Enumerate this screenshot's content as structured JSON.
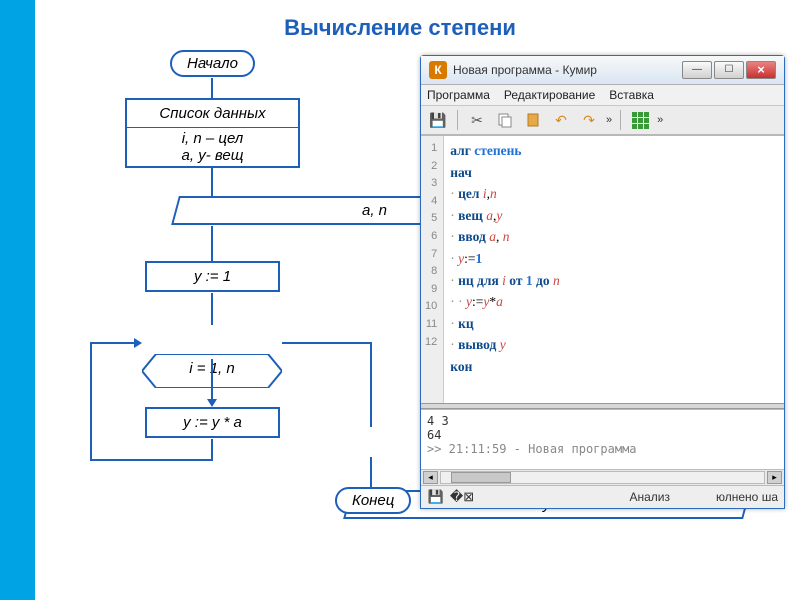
{
  "page": {
    "title": "Вычисление степени"
  },
  "flow": {
    "start": "Начало",
    "data_label": "Список данных",
    "types_int": "i, n – цел",
    "types_real": "a, y- вещ",
    "input": "a, n",
    "init": "y := 1",
    "loop": "i = 1, n",
    "body": "y := y * a",
    "output": "y",
    "end": "Конец"
  },
  "window": {
    "app_icon_letter": "К",
    "title": "Новая программа - Кумир",
    "menu": {
      "program": "Программа",
      "edit": "Редактирование",
      "insert": "Вставка"
    },
    "code_lines": [
      {
        "n": 1,
        "raw": "алг степень"
      },
      {
        "n": 2,
        "raw": "нач"
      },
      {
        "n": 3,
        "raw": "· цел i,n"
      },
      {
        "n": 4,
        "raw": "· вещ a,y"
      },
      {
        "n": 5,
        "raw": "· ввод a, n"
      },
      {
        "n": 6,
        "raw": "· y:=1"
      },
      {
        "n": 7,
        "raw": "· нц для i от 1 до n"
      },
      {
        "n": 8,
        "raw": "· · y:=y*a"
      },
      {
        "n": 9,
        "raw": "· кц"
      },
      {
        "n": 10,
        "raw": "· вывод y"
      },
      {
        "n": 11,
        "raw": "кон"
      },
      {
        "n": 12,
        "raw": ""
      }
    ],
    "console": {
      "input": "4 3",
      "output": "64",
      "log": ">> 21:11:59 - Новая программа"
    },
    "status": {
      "analysis": "Анализ",
      "exec": "юлнено ша"
    }
  }
}
